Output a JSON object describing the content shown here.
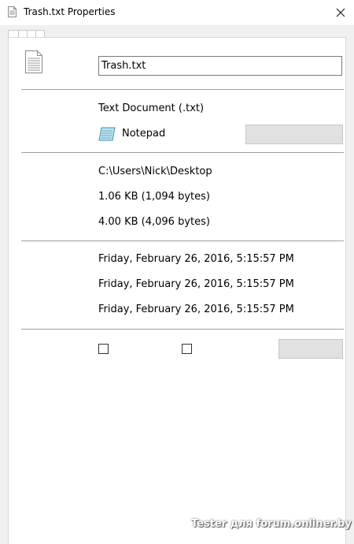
{
  "window": {
    "title": "Trash.txt Properties",
    "close_icon": "close-icon"
  },
  "general": {
    "file_name": "Trash.txt",
    "type_of_file": "Text Document (.txt)",
    "opens_with": "Notepad",
    "location": "C:\\Users\\Nick\\Desktop",
    "size": "1.06 KB (1,094 bytes)",
    "size_on_disk": "4.00 KB (4,096 bytes)",
    "created": "Friday, February 26, 2016, 5:15:57 PM",
    "modified": "Friday, February 26, 2016, 5:15:57 PM",
    "accessed": "Friday, February 26, 2016, 5:15:57 PM",
    "read_only_checked": false,
    "hidden_checked": false
  },
  "watermark": "Tester для forum.onliner.by",
  "icons": {
    "title_icon": "text-file-icon",
    "file_icon": "text-file-icon",
    "app_icon": "notepad-icon"
  }
}
